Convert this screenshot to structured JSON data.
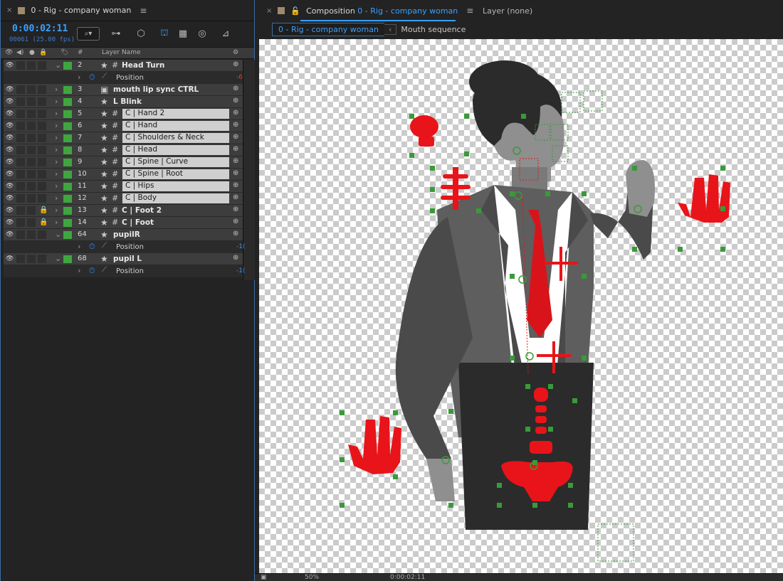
{
  "timeline": {
    "tab_close": "×",
    "tab_title": "0 - Rig - company woman",
    "tab_menu": "≡",
    "timecode": "0:00:02:11",
    "fps": "00061 (25.00 fps)",
    "search_icon": "⌕▾",
    "col_layer_name": "Layer Name",
    "col_hash": "#",
    "layers": [
      {
        "num": "2",
        "name": "Head Turn",
        "expanded": true,
        "boxed": false
      },
      {
        "sub": true,
        "prop": "Position",
        "value": "-6",
        "value_color": "red"
      },
      {
        "num": "3",
        "name": "mouth lip sync CTRL",
        "expanded": false,
        "boxed": false,
        "comp": true
      },
      {
        "num": "4",
        "name": "L Blink",
        "expanded": false,
        "boxed": false,
        "nohash": true
      },
      {
        "num": "5",
        "name": "C | Hand 2",
        "boxed": true
      },
      {
        "num": "6",
        "name": "C | Hand",
        "boxed": true
      },
      {
        "num": "7",
        "name": "C | Shoulders & Neck",
        "boxed": true
      },
      {
        "num": "8",
        "name": "C | Head",
        "boxed": true
      },
      {
        "num": "9",
        "name": "C | Spine | Curve",
        "boxed": true
      },
      {
        "num": "10",
        "name": "C | Spine | Root",
        "boxed": true
      },
      {
        "num": "11",
        "name": "C | Hips",
        "boxed": true
      },
      {
        "num": "12",
        "name": "C | Body",
        "boxed": true
      },
      {
        "num": "13",
        "name": "C | Foot 2",
        "boxed": false,
        "locked": true
      },
      {
        "num": "14",
        "name": "C | Foot",
        "boxed": false,
        "locked": true
      },
      {
        "num": "64",
        "name": "pupilR",
        "expanded": true,
        "boxed": false,
        "nohash": true
      },
      {
        "sub": true,
        "prop": "Position",
        "value": "-1(",
        "value_color": "blue"
      },
      {
        "num": "68",
        "name": "pupil L",
        "expanded": true,
        "boxed": false,
        "nohash": true
      },
      {
        "sub": true,
        "prop": "Position",
        "value": "-1(",
        "value_color": "blue"
      }
    ]
  },
  "composition": {
    "tab_close": "×",
    "tab_prefix": "Composition",
    "tab_comp_name": "0 - Rig - company woman",
    "tab_menu": "≡",
    "layer_tab": "Layer  (none)",
    "breadcrumb_active": "0 - Rig - company woman",
    "breadcrumb_next": "Mouth sequence"
  },
  "statusbar": {
    "zoom": "50%",
    "time": "0:00:02:11"
  },
  "colors": {
    "accent": "#3aa0ff",
    "label_green": "#3fa63f",
    "controller_red": "#e8141a",
    "handle_green": "#3a9a3a"
  }
}
